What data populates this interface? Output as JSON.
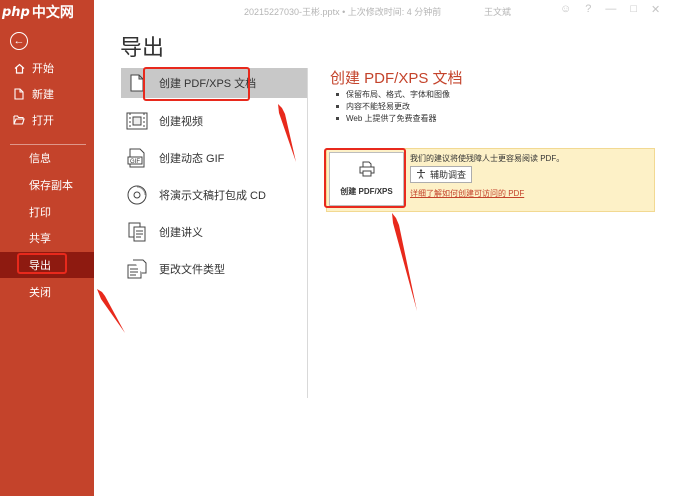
{
  "app": {
    "logo_php": "php",
    "logo_cn": "中文网",
    "window_title": "20215227030-王彬.pptx • 上次修改时间: 4 分钟前",
    "user": "王文斌"
  },
  "sidebar": {
    "items": [
      {
        "label": "开始",
        "icon": "home-icon"
      },
      {
        "label": "新建",
        "icon": "new-file-icon"
      },
      {
        "label": "打开",
        "icon": "folder-open-icon"
      },
      {
        "label": "信息"
      },
      {
        "label": "保存副本"
      },
      {
        "label": "打印"
      },
      {
        "label": "共享"
      },
      {
        "label": "导出"
      },
      {
        "label": "关闭"
      }
    ],
    "active": "导出"
  },
  "page": {
    "title": "导出"
  },
  "export_options": [
    {
      "label": "创建 PDF/XPS 文档",
      "icon": "pdf-document-icon",
      "selected": true
    },
    {
      "label": "创建视频",
      "icon": "video-icon"
    },
    {
      "label": "创建动态 GIF",
      "icon": "gif-icon"
    },
    {
      "label": "将演示文稿打包成 CD",
      "icon": "cd-icon"
    },
    {
      "label": "创建讲义",
      "icon": "handout-icon"
    },
    {
      "label": "更改文件类型",
      "icon": "change-file-type-icon"
    }
  ],
  "detail": {
    "title": "创建 PDF/XPS 文档",
    "bullets": [
      "保留布局、格式、字体和图像",
      "内容不能轻易更改",
      "Web 上提供了免费查看器"
    ],
    "advice": "我们的建议将使残障人士更容易阅读 PDF。",
    "assist_button": "辅助调查",
    "learn_link": "详细了解如何创建可访问的 PDF",
    "create_button": "创建 PDF/XPS"
  },
  "colors": {
    "sidebar_bg": "#c4432b",
    "sidebar_active": "#8e1a10",
    "accent_text": "#c4432b",
    "annotation_red": "#e8291c",
    "info_panel_bg": "#fdf1c7"
  }
}
